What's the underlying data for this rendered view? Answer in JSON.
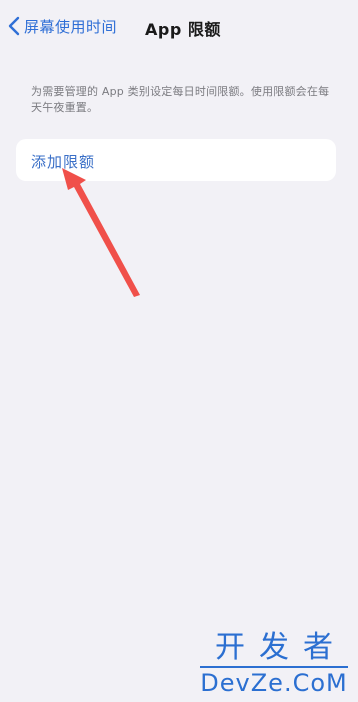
{
  "nav": {
    "back_label": "屏幕使用时间",
    "title": "App 限额"
  },
  "description": "为需要管理的 App 类别设定每日时间限额。使用限额会在每天午夜重置。",
  "add_limit_label": "添加限额",
  "watermark": {
    "cn": "开发者",
    "en": "DevZe.CoM"
  },
  "colors": {
    "accent": "#2f6fd6",
    "annotation_arrow": "#f0504a",
    "background": "#f2f1f6"
  },
  "icons": {
    "back": "chevron-left-icon",
    "annotation": "red-arrow-annotation"
  }
}
